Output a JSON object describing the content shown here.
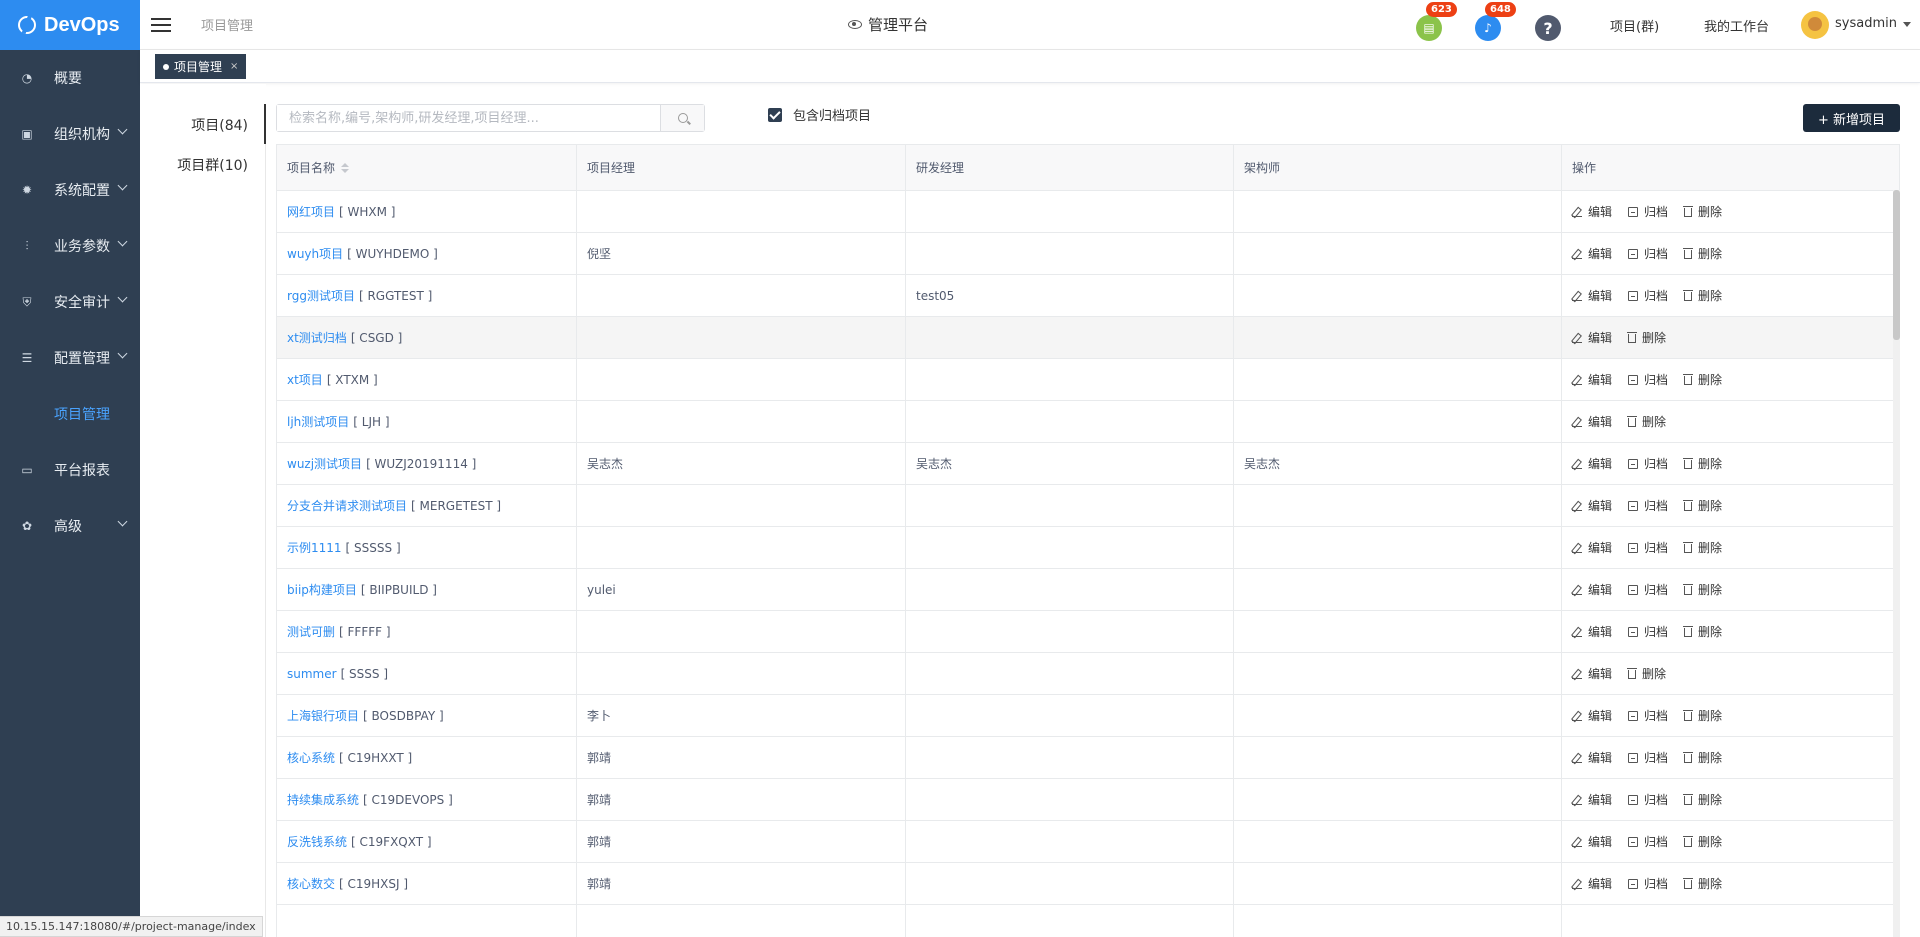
{
  "brand": {
    "name": "DevOps"
  },
  "sidebar": {
    "items": [
      {
        "label": "概要",
        "icon": "dashboard-icon",
        "glyph": "◔",
        "chevron": false,
        "active": false
      },
      {
        "label": "组织机构",
        "icon": "lock-icon",
        "glyph": "▣",
        "chevron": true,
        "active": false
      },
      {
        "label": "系统配置",
        "icon": "gear-icon",
        "glyph": "✹",
        "chevron": true,
        "active": false
      },
      {
        "label": "业务参数",
        "icon": "sliders-icon",
        "glyph": "⫶",
        "chevron": true,
        "active": false
      },
      {
        "label": "安全审计",
        "icon": "shield-icon",
        "glyph": "⛨",
        "chevron": true,
        "active": false
      },
      {
        "label": "配置管理",
        "icon": "database-icon",
        "glyph": "☰",
        "chevron": true,
        "active": false
      },
      {
        "label": "项目管理",
        "icon": "grid-icon",
        "glyph": "",
        "chevron": false,
        "active": true
      },
      {
        "label": "平台报表",
        "icon": "monitor-icon",
        "glyph": "▭",
        "chevron": false,
        "active": false
      },
      {
        "label": "高级",
        "icon": "palette-icon",
        "glyph": "✿",
        "chevron": true,
        "active": false
      }
    ]
  },
  "header": {
    "breadcrumb": "项目管理",
    "platform_title": "管理平台",
    "notifications": [
      {
        "icon": "clipboard-icon",
        "glyph": "▤",
        "count": "623",
        "color": "#8bc34a"
      },
      {
        "icon": "bell-icon",
        "glyph": "♪",
        "count": "648",
        "color": "#2d8cf0"
      }
    ],
    "help_glyph": "?",
    "help_color": "#515a6e",
    "links": {
      "project_group": "项目(群)",
      "workspace": "我的工作台"
    },
    "user": "sysadmin"
  },
  "tabs": [
    {
      "label": "项目管理",
      "close": "×"
    }
  ],
  "subnav": {
    "projects": "项目(84)",
    "groups": "项目群(10)"
  },
  "toolbar": {
    "search_placeholder": "检索名称,编号,架构师,研发经理,项目经理...",
    "include_archived_label": "包含归档项目",
    "add_label": "+ 新增项目"
  },
  "table": {
    "columns": [
      "项目名称",
      "项目经理",
      "研发经理",
      "架构师",
      "操作"
    ],
    "actions": {
      "edit": "编辑",
      "archive": "归档",
      "delete": "删除"
    },
    "rows": [
      {
        "name": "网红项目",
        "code": "[ WHXM ]",
        "pm": "",
        "dev": "",
        "arch": "",
        "archivable": true
      },
      {
        "name": "wuyh项目",
        "code": "[ WUYHDEMO ]",
        "pm": "倪坚",
        "dev": "",
        "arch": "",
        "archivable": true
      },
      {
        "name": "rgg测试项目",
        "code": "[ RGGTEST ]",
        "pm": "",
        "dev": "test05",
        "arch": "",
        "archivable": true
      },
      {
        "name": "xt测试归档",
        "code": "[ CSGD ]",
        "pm": "",
        "dev": "",
        "arch": "",
        "archivable": false
      },
      {
        "name": "xt项目",
        "code": "[ XTXM ]",
        "pm": "",
        "dev": "",
        "arch": "",
        "archivable": true
      },
      {
        "name": "ljh测试项目",
        "code": "[ LJH ]",
        "pm": "",
        "dev": "",
        "arch": "",
        "archivable": false
      },
      {
        "name": "wuzj测试项目",
        "code": "[ WUZJ20191114 ]",
        "pm": "吴志杰",
        "dev": "吴志杰",
        "arch": "吴志杰",
        "archivable": true
      },
      {
        "name": "分支合并请求测试项目",
        "code": "[ MERGETEST ]",
        "pm": "",
        "dev": "",
        "arch": "",
        "archivable": true
      },
      {
        "name": "示例1111",
        "code": "[ SSSSS ]",
        "pm": "",
        "dev": "",
        "arch": "",
        "archivable": true
      },
      {
        "name": "biip构建项目",
        "code": "[ BIIPBUILD ]",
        "pm": "yulei",
        "dev": "",
        "arch": "",
        "archivable": true
      },
      {
        "name": "测试可删",
        "code": "[ FFFFF ]",
        "pm": "",
        "dev": "",
        "arch": "",
        "archivable": true
      },
      {
        "name": "summer",
        "code": "[ SSSS ]",
        "pm": "",
        "dev": "",
        "arch": "",
        "archivable": false
      },
      {
        "name": "上海银行项目",
        "code": "[ BOSDBPAY ]",
        "pm": "李卜",
        "dev": "",
        "arch": "",
        "archivable": true
      },
      {
        "name": "核心系统",
        "code": "[ C19HXXT ]",
        "pm": "郭靖",
        "dev": "",
        "arch": "",
        "archivable": true
      },
      {
        "name": "持续集成系统",
        "code": "[ C19DEVOPS ]",
        "pm": "郭靖",
        "dev": "",
        "arch": "",
        "archivable": true
      },
      {
        "name": "反洗钱系统",
        "code": "[ C19FXQXT ]",
        "pm": "郭靖",
        "dev": "",
        "arch": "",
        "archivable": true
      },
      {
        "name": "核心数交",
        "code": "[ C19HXSJ ]",
        "pm": "郭靖",
        "dev": "",
        "arch": "",
        "archivable": true
      },
      {
        "name": "",
        "code": "",
        "pm": "",
        "dev": "",
        "arch": "",
        "archivable": false,
        "blank": true
      }
    ]
  },
  "status_url": "10.15.15.147:18080/#/project-manage/index"
}
